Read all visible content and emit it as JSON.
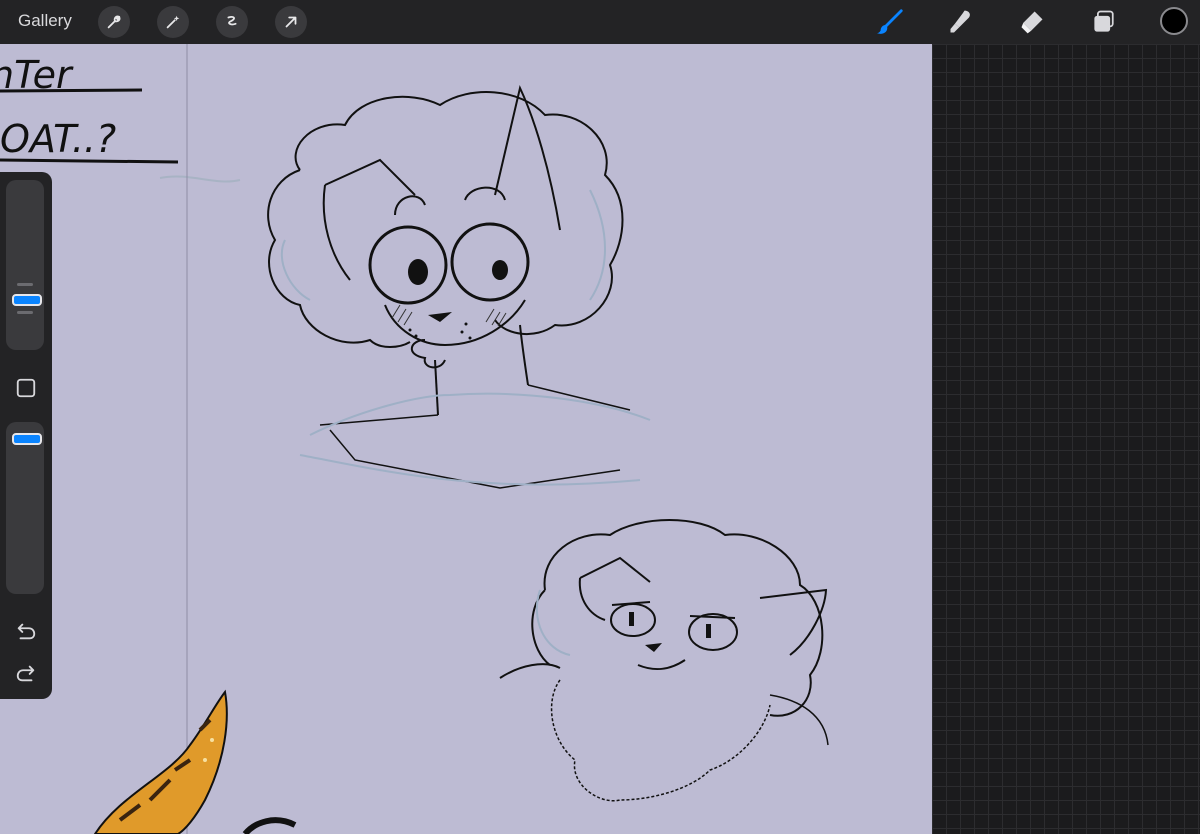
{
  "topbar": {
    "gallery_label": "Gallery",
    "left_tools": [
      "wrench-icon",
      "magic-wand-icon",
      "selection-icon",
      "transform-arrow-icon"
    ],
    "right_tools": [
      "brush-icon",
      "smudge-icon",
      "eraser-icon",
      "layers-icon"
    ],
    "active_tool": "brush",
    "accent_color": "#0a84ff",
    "current_color": "#000000"
  },
  "canvas": {
    "background_color": "#bdbbd3",
    "handwritten_text": [
      "nTer",
      "OAT..?"
    ]
  },
  "sidebar": {
    "brush_size_level": 0.5,
    "opacity_level": 0.95,
    "icons": [
      "modify-square-icon",
      "undo-icon",
      "redo-icon"
    ]
  }
}
